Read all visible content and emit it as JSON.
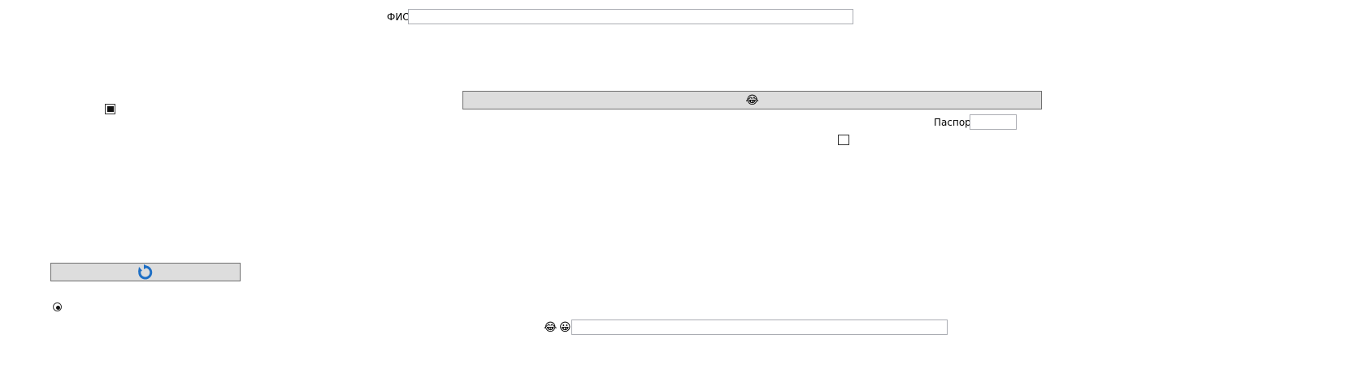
{
  "form": {
    "fio_label": "ФИО",
    "fio_value": "",
    "passport_label": "Паспорт",
    "passport_value": "",
    "bottom_input_value": ""
  },
  "buttons": {
    "wide_button_icon": "grinning-squint-emoji",
    "wide_button_glyph": "😂",
    "refresh_button_icon": "refresh-icon"
  },
  "checks": {
    "left_checkbox_state": "indeterminate",
    "right_checkbox_state": "unchecked",
    "radio_state": "checked"
  },
  "bottom_row": {
    "emoji_1_glyph": "😂",
    "emoji_1_icon": "laughing-tears-emoji",
    "emoji_2_glyph": "😀",
    "emoji_2_icon": "grinning-emoji"
  },
  "colors": {
    "button_bg": "#dddddd",
    "refresh_icon": "#1e6fc5",
    "input_border": "#abadb3"
  }
}
